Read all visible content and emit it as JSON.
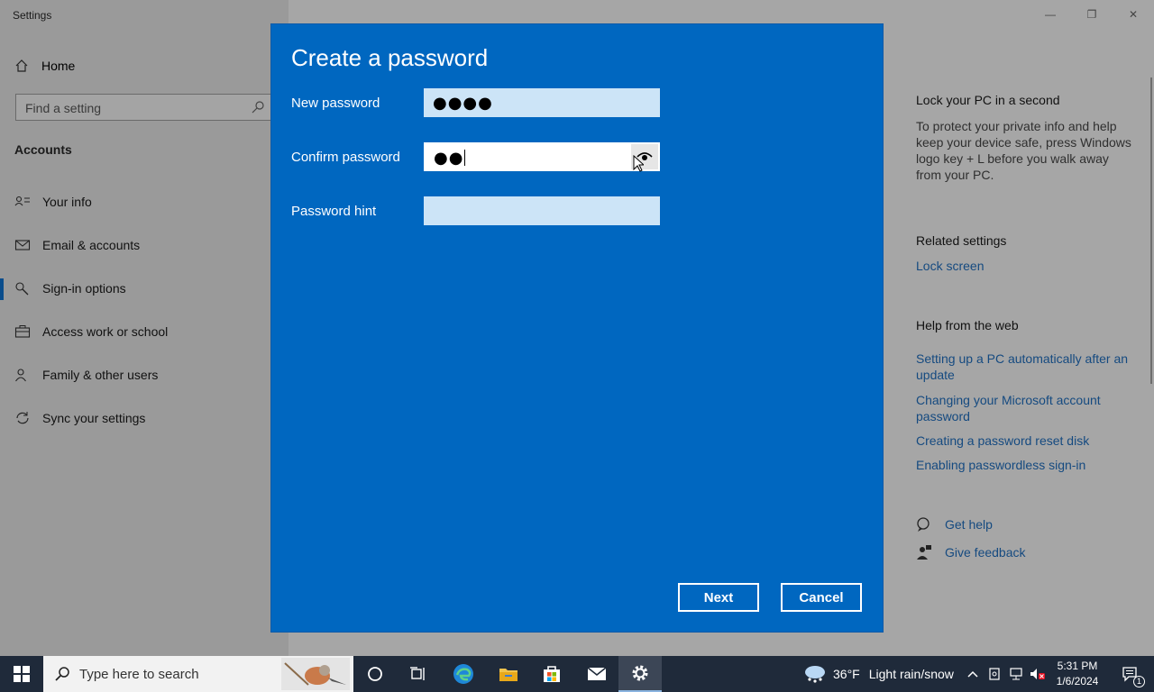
{
  "window": {
    "app_title": "Settings",
    "controls": {
      "minimize": "—",
      "maximize": "❐",
      "close": "✕"
    }
  },
  "sidebar": {
    "home_label": "Home",
    "search_placeholder": "Find a setting",
    "section_title": "Accounts",
    "items": [
      {
        "label": "Your info",
        "icon": "person-card-icon",
        "active": false
      },
      {
        "label": "Email & accounts",
        "icon": "mail-icon",
        "active": false
      },
      {
        "label": "Sign-in options",
        "icon": "key-icon",
        "active": true
      },
      {
        "label": "Access work or school",
        "icon": "briefcase-icon",
        "active": false
      },
      {
        "label": "Family & other users",
        "icon": "person-add-icon",
        "active": false
      },
      {
        "label": "Sync your settings",
        "icon": "sync-icon",
        "active": false
      }
    ]
  },
  "right_pane": {
    "lock_heading": "Lock your PC in a second",
    "lock_text": "To protect your private info and help keep your device safe, press Windows logo key + L before you walk away from your PC.",
    "related_heading": "Related settings",
    "related_link": "Lock screen",
    "help_heading": "Help from the web",
    "help_links": [
      "Setting up a PC automatically after an update",
      "Changing your Microsoft account password",
      "Creating a password reset disk",
      "Enabling passwordless sign-in"
    ],
    "get_help": "Get help",
    "give_feedback": "Give feedback"
  },
  "dialog": {
    "title": "Create a password",
    "new_password_label": "New password",
    "new_password_value": "●●●●",
    "confirm_password_label": "Confirm password",
    "confirm_password_value": "●●",
    "hint_label": "Password hint",
    "hint_value": "",
    "next_label": "Next",
    "cancel_label": "Cancel"
  },
  "taskbar": {
    "search_placeholder": "Type here to search",
    "apps": [
      "cortana-icon",
      "task-view-icon",
      "edge-icon",
      "file-explorer-icon",
      "store-icon",
      "mail-icon",
      "settings-icon"
    ],
    "weather_temp": "36°F",
    "weather_desc": "Light rain/snow",
    "time": "5:31 PM",
    "date": "1/6/2024",
    "notification_count": "1"
  },
  "colors": {
    "dialog_bg": "#0067c0",
    "field_bg": "#cce4f7",
    "link": "#154a80",
    "taskbar": "#1f2a3a"
  }
}
